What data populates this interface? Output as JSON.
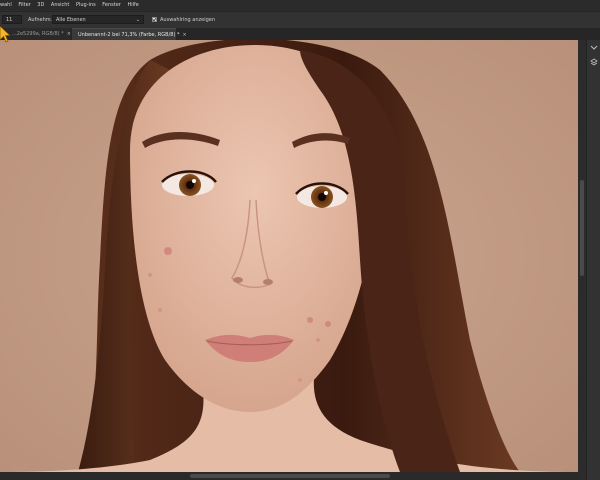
{
  "menubar": {
    "items": [
      "wahl",
      "Filter",
      "3D",
      "Ansicht",
      "Plug-ins",
      "Fenster",
      "Hilfe"
    ]
  },
  "options": {
    "field_left_value": "11",
    "aufnehmen_label": "Aufnehm.:",
    "sample_value": "Alle Ebenen",
    "checkbox_label": "Auswahlring anzeigen"
  },
  "tabs": [
    {
      "label": "...2e5299a, RGB/8) *",
      "close": "×",
      "active": false
    },
    {
      "label": "Unbenannt-2 bei 71,3% (Farbe, RGB/8) *",
      "close": "×",
      "active": true
    }
  ],
  "colors": {
    "canvas_background": "#c59e86",
    "skin": "#e3b8a2",
    "hair": "#4a2618",
    "iris": "#7a4317",
    "lips": "#c97b76",
    "cursor": "#f6b52a"
  },
  "icons": {
    "cursor": "pointer-cursor-icon",
    "panel_top": "panel-collapse-icon",
    "panel_layers": "layers-icon"
  }
}
